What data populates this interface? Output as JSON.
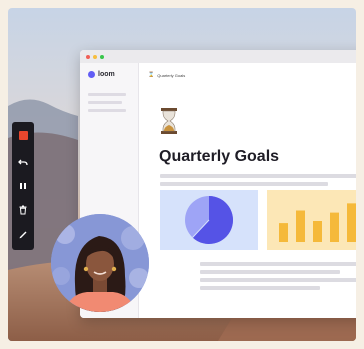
{
  "window": {
    "brand": "loom",
    "breadcrumb": "Quarterly Goals"
  },
  "document": {
    "title": "Quarterly Goals",
    "pie_fraction_highlighted": 0.62,
    "bar_levels": [
      0.45,
      0.75,
      0.5,
      0.7,
      0.92
    ]
  },
  "toolbar": {
    "items": [
      "record-icon",
      "undo-icon",
      "pause-icon",
      "trash-icon",
      "pen-icon"
    ]
  },
  "colors": {
    "brand": "#625df5",
    "record": "#e8462d",
    "pie_card": "#d6e2fb",
    "bar_card": "#fce7b6",
    "bars": "#f5b93a"
  }
}
